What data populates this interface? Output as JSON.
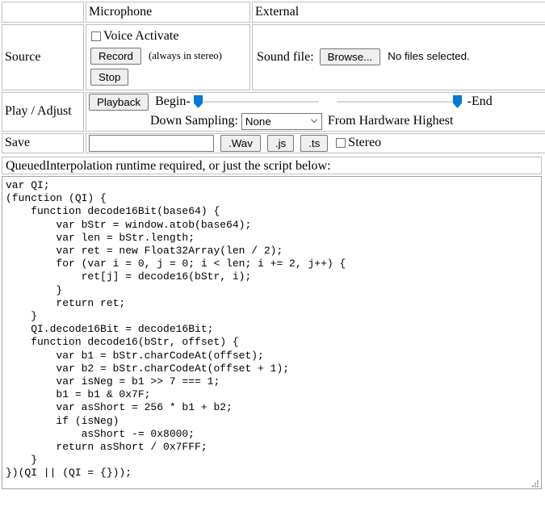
{
  "columns": {
    "blank": "",
    "microphone": "Microphone",
    "external": "External"
  },
  "rows": {
    "source": {
      "label": "Source",
      "voice_activate_label": "Voice Activate",
      "voice_activate_checked": false,
      "record_button": "Record",
      "record_note": "(always in stereo)",
      "stop_button": "Stop",
      "sound_file_label": "Sound file:",
      "browse_button": "Browse...",
      "file_status": "No files selected."
    },
    "play_adjust": {
      "label": "Play / Adjust",
      "playback_button": "Playback",
      "begin_label": "Begin-",
      "end_label": "-End",
      "begin_slider_value": 0,
      "end_slider_value": 100,
      "down_sampling_label": "Down Sampling:",
      "down_sampling_value": "None",
      "down_sampling_options": [
        "None"
      ],
      "from_hardware_label": "From Hardware Highest"
    },
    "save": {
      "label": "Save",
      "filename_value": "",
      "filename_placeholder": "",
      "wav_button": ".Wav",
      "js_button": ".js",
      "ts_button": ".ts",
      "stereo_label": "Stereo",
      "stereo_checked": false
    }
  },
  "note": "QueuedInterpolation runtime required, or just the script below:",
  "code": "var QI;\n(function (QI) {\n    function decode16Bit(base64) {\n        var bStr = window.atob(base64);\n        var len = bStr.length;\n        var ret = new Float32Array(len / 2);\n        for (var i = 0, j = 0; i < len; i += 2, j++) {\n            ret[j] = decode16(bStr, i);\n        }\n        return ret;\n    }\n    QI.decode16Bit = decode16Bit;\n    function decode16(bStr, offset) {\n        var b1 = bStr.charCodeAt(offset);\n        var b2 = bStr.charCodeAt(offset + 1);\n        var isNeg = b1 >> 7 === 1;\n        b1 = b1 & 0x7F;\n        var asShort = 256 * b1 + b2;\n        if (isNeg)\n            asShort -= 0x8000;\n        return asShort / 0x7FFF;\n    }\n})(QI || (QI = {}));",
  "colors": {
    "slider_thumb": "#0078d7",
    "slider_track": "#d6d6d6",
    "cell_border": "#bfbfbf",
    "button_face": "#efefef",
    "button_border": "#767676"
  }
}
